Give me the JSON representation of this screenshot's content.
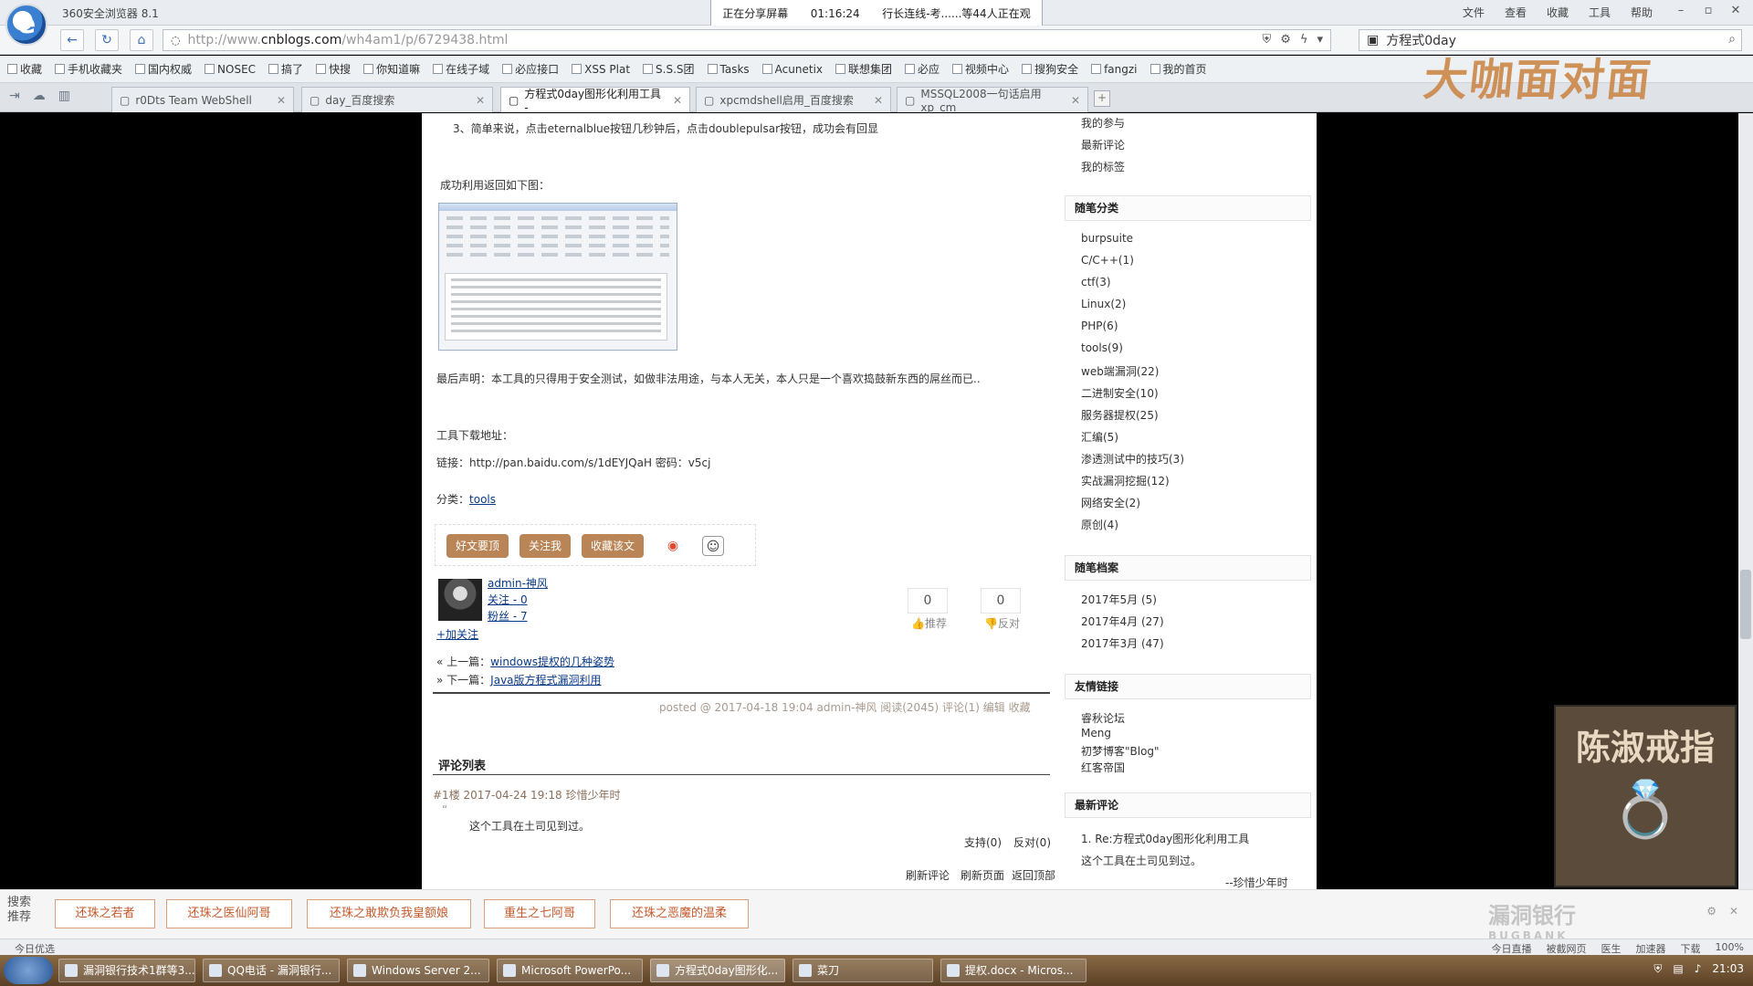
{
  "browser": {
    "title": "360安全浏览器 8.1",
    "share": {
      "label": "正在分享屏幕",
      "time": "01:16:24",
      "status": "行长连线-考......等44人正在观"
    },
    "menu": [
      "文件",
      "查看",
      "收藏",
      "工具",
      "帮助"
    ]
  },
  "address": {
    "url_prefix": "http://www.",
    "url_domain": "cnblogs.com",
    "url_path": "/wh4am1/p/6729438.html",
    "search_value": "方程式0day"
  },
  "bookmarks": [
    "收藏",
    "手机收藏夹",
    "国内权威",
    "NOSEC",
    "搞了",
    "快搜",
    "你知道嘛",
    "在线子域",
    "必应接口",
    "XSS Plat",
    "S.S.S团",
    "Tasks",
    "Acunetix",
    "联想集团",
    "必应",
    "视频中心",
    "搜狗安全",
    "fangzi",
    "我的首页"
  ],
  "tabs": [
    {
      "label": "r0Dts Team WebShell",
      "active": false
    },
    {
      "label": "day_百度搜索",
      "active": false
    },
    {
      "label": "方程式0day图形化利用工具 -",
      "active": true
    },
    {
      "label": "xpcmdshell启用_百度搜索",
      "active": false
    },
    {
      "label": "MSSQL2008一句话启用xp_cm",
      "active": false
    }
  ],
  "article": {
    "step3": "3、简单来说，点击eternalblue按钮几秒钟后，点击doublepulsar按钮，成功会有回显",
    "success_label": "成功利用返回如下图：",
    "disclaimer": "最后声明：本工具的只得用于安全测试，如做非法用途，与本人无关，本人只是一个喜欢捣鼓新东西的屌丝而已..",
    "download_label": "工具下载地址：",
    "link_line": "链接：http://pan.baidu.com/s/1dEYJQaH 密码：v5cj",
    "category_label": "分类：",
    "category": "tools",
    "buttons": [
      "好文要顶",
      "关注我",
      "收藏该文"
    ],
    "weibo_icon": "weibo-icon",
    "wechat_icon": "wechat-icon",
    "author": {
      "name": "admin-神风",
      "follow": "关注 - 0",
      "fans": "粉丝 - 7",
      "add_follow": "+加关注"
    },
    "votes": {
      "up": "0",
      "down": "0",
      "up_label": "推荐",
      "down_label": "反对"
    },
    "prev": {
      "label": "« 上一篇：",
      "title": "windows提权的几种姿势"
    },
    "next": {
      "label": "» 下一篇：",
      "title": "Java版方程式漏洞利用"
    },
    "posted": "posted @ 2017-04-18 19:04 admin-神风 阅读(2045) 评论(1) 编辑 收藏"
  },
  "comments": {
    "title": "评论列表",
    "items": [
      {
        "meta": "#1楼 2017-04-24 19:18 珍惜少年时",
        "text": "这个工具在土司见到过。",
        "support": "支持(0)",
        "oppose": "反对(0)"
      }
    ],
    "actions": [
      "刷新评论",
      "刷新页面",
      "返回顶部"
    ]
  },
  "sidebar": {
    "top_links": [
      "我的参与",
      "最新评论",
      "我的标签"
    ],
    "categories_title": "随笔分类",
    "categories": [
      "burpsuite",
      "C/C++(1)",
      "ctf(3)",
      "Linux(2)",
      "PHP(6)",
      "tools(9)",
      "web端漏洞(22)",
      "二进制安全(10)",
      "服务器提权(25)",
      "汇编(5)",
      "渗透测试中的技巧(3)",
      "实战漏洞挖掘(12)",
      "网络安全(2)",
      "原创(4)"
    ],
    "archives_title": "随笔档案",
    "archives": [
      "2017年5月 (5)",
      "2017年4月 (27)",
      "2017年3月 (47)"
    ],
    "friends_title": "友情链接",
    "friends": [
      "睿秋论坛",
      "Meng",
      "初梦博客\"Blog\"",
      "红客帝国"
    ],
    "recent_title": "最新评论",
    "recent": {
      "title": "1. Re:方程式0day图形化利用工具",
      "text": "这个工具在土司见到过。",
      "author": "--珍惜少年时"
    }
  },
  "watermark": "大咖面对面",
  "vod_title": "陈淑戒指",
  "ad": {
    "label": "搜索推荐",
    "items": [
      "还珠之若者",
      "还珠之医仙阿哥",
      "还珠之敢欺负我皇额娘",
      "重生之七阿哥",
      "还珠之恶魔的温柔"
    ],
    "brand": "漏洞银行",
    "brand_en": "BUGBANK"
  },
  "status": {
    "left": "今日优选",
    "right": [
      "今日直播",
      "被截网页",
      "医生",
      "加速器",
      "下载",
      "100%"
    ]
  },
  "taskbar": {
    "items": [
      "漏洞银行技术1群等3...",
      "QQ电话 - 漏洞银行...",
      "Windows Server 2...",
      "Microsoft PowerPo...",
      "方程式0day图形化...",
      "菜刀",
      "提权.docx - Micros..."
    ],
    "clock": "21:03"
  }
}
